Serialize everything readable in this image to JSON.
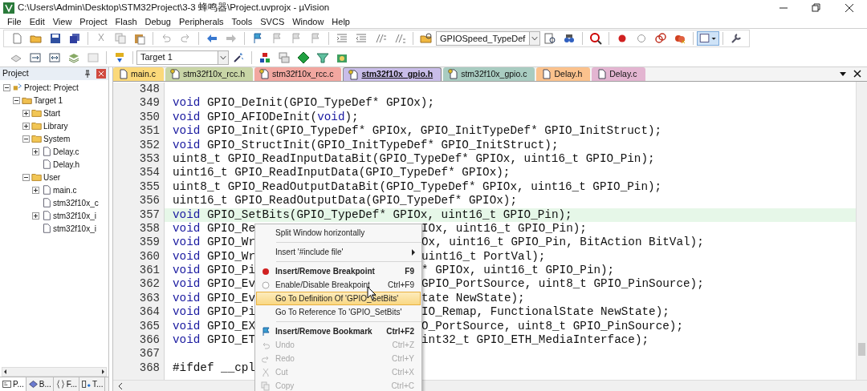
{
  "window": {
    "title": "C:\\Users\\Admin\\Desktop\\STM32Project\\3-3 蜂鸣器\\Project.uvprojx - µVision"
  },
  "menu_bar": [
    "File",
    "Edit",
    "View",
    "Project",
    "Flash",
    "Debug",
    "Peripherals",
    "Tools",
    "SVCS",
    "Window",
    "Help"
  ],
  "toolbar": {
    "find_combo": "GPIOSpeed_TypeDef",
    "target_combo": "Target 1"
  },
  "project_panel": {
    "title": "Project",
    "tree": [
      {
        "label": "Project: Project",
        "kind": "project",
        "expanded": true,
        "children": [
          {
            "label": "Target 1",
            "kind": "target",
            "expanded": true,
            "children": [
              {
                "label": "Start",
                "kind": "folder",
                "expanded": false
              },
              {
                "label": "Library",
                "kind": "folder",
                "expanded": false
              },
              {
                "label": "System",
                "kind": "folder",
                "expanded": true,
                "children": [
                  {
                    "label": "Delay.c",
                    "kind": "file",
                    "expanded": false
                  },
                  {
                    "label": "Delay.h",
                    "kind": "file"
                  }
                ]
              },
              {
                "label": "User",
                "kind": "folder",
                "expanded": true,
                "children": [
                  {
                    "label": "main.c",
                    "kind": "file",
                    "expanded": false
                  },
                  {
                    "label": "stm32f10x_c",
                    "kind": "file"
                  },
                  {
                    "label": "stm32f10x_i",
                    "kind": "file",
                    "expanded": false
                  },
                  {
                    "label": "stm32f10x_i",
                    "kind": "file"
                  }
                ]
              }
            ]
          }
        ]
      }
    ],
    "bottom_tabs": [
      {
        "label": "P...",
        "kind": "project",
        "selected": true
      },
      {
        "label": "B...",
        "kind": "books",
        "selected": false
      },
      {
        "label": "F...",
        "kind": "functions",
        "selected": false
      },
      {
        "label": "T...",
        "kind": "templates",
        "selected": false
      }
    ]
  },
  "editor": {
    "tabs": [
      {
        "label": "main.c",
        "color": "#fbd97a",
        "locked": false,
        "selected": false
      },
      {
        "label": "stm32f10x_rcc.h",
        "color": "#c8d5a6",
        "locked": true,
        "selected": false
      },
      {
        "label": "stm32f10x_rcc.c",
        "color": "#f2a7a0",
        "locked": true,
        "selected": false
      },
      {
        "label": "stm32f10x_gpio.h",
        "color": "#c9bde9",
        "locked": true,
        "selected": true
      },
      {
        "label": "stm32f10x_gpio.c",
        "color": "#a9ccc1",
        "locked": true,
        "selected": false
      },
      {
        "label": "Delay.h",
        "color": "#fbc28d",
        "locked": false,
        "selected": false
      },
      {
        "label": "Delay.c",
        "color": "#e3b5d1",
        "locked": false,
        "selected": false
      }
    ],
    "lines": [
      {
        "number": "348",
        "current": false
      },
      {
        "number": "349",
        "current": false,
        "segments": [
          {
            "kind": "keyword",
            "text": "void"
          },
          {
            "kind": "plain",
            "text": " GPIO_DeInit(GPIO_TypeDef* GPIOx);"
          }
        ]
      },
      {
        "number": "350",
        "current": false,
        "segments": [
          {
            "kind": "keyword",
            "text": "void"
          },
          {
            "kind": "plain",
            "text": " GPIO_AFIODeInit("
          },
          {
            "kind": "keyword",
            "text": "void"
          },
          {
            "kind": "plain",
            "text": ");"
          }
        ]
      },
      {
        "number": "351",
        "current": false,
        "segments": [
          {
            "kind": "keyword",
            "text": "void"
          },
          {
            "kind": "plain",
            "text": " GPIO_Init(GPIO_TypeDef* GPIOx, GPIO_InitTypeDef* GPIO_InitStruct);"
          }
        ]
      },
      {
        "number": "352",
        "current": false,
        "segments": [
          {
            "kind": "keyword",
            "text": "void"
          },
          {
            "kind": "plain",
            "text": " GPIO_StructInit(GPIO_InitTypeDef* GPIO_InitStruct);"
          }
        ]
      },
      {
        "number": "353",
        "current": false,
        "segments": [
          {
            "kind": "plain",
            "text": "uint8_t GPIO_ReadInputDataBit(GPIO_TypeDef* GPIOx, uint16_t GPIO_Pin);"
          }
        ]
      },
      {
        "number": "354",
        "current": false,
        "segments": [
          {
            "kind": "plain",
            "text": "uint16_t GPIO_ReadInputData(GPIO_TypeDef* GPIOx);"
          }
        ]
      },
      {
        "number": "355",
        "current": false,
        "segments": [
          {
            "kind": "plain",
            "text": "uint8_t GPIO_ReadOutputDataBit(GPIO_TypeDef* GPIOx, uint16_t GPIO_Pin);"
          }
        ]
      },
      {
        "number": "356",
        "current": false,
        "segments": [
          {
            "kind": "plain",
            "text": "uint16_t GPIO_ReadOutputData(GPIO_TypeDef* GPIOx);"
          }
        ]
      },
      {
        "number": "357",
        "current": true,
        "segments": [
          {
            "kind": "keyword",
            "text": "void"
          },
          {
            "kind": "plain",
            "text": " GPIO_SetBits(GPIO_TypeDef* GPIOx, uint16_t GPIO_Pin);"
          }
        ]
      },
      {
        "number": "358",
        "current": false,
        "segments": [
          {
            "kind": "keyword",
            "text": "void"
          },
          {
            "kind": "plain",
            "text": " GPIO_Re"
          }
        ],
        "after_menu": "IOx, uint16_t GPIO_Pin);"
      },
      {
        "number": "359",
        "current": false,
        "segments": [
          {
            "kind": "keyword",
            "text": "void"
          },
          {
            "kind": "plain",
            "text": " GPIO_Wr"
          }
        ],
        "after_menu": "Ox, uint16_t GPIO_Pin, BitAction BitVal);"
      },
      {
        "number": "360",
        "current": false,
        "segments": [
          {
            "kind": "keyword",
            "text": "void"
          },
          {
            "kind": "plain",
            "text": " GPIO_Wr"
          }
        ],
        "after_menu": "uint16_t PortVal);"
      },
      {
        "number": "361",
        "current": false,
        "segments": [
          {
            "kind": "keyword",
            "text": "void"
          },
          {
            "kind": "plain",
            "text": " GPIO_Pi"
          }
        ],
        "after_menu": "* GPIOx, uint16_t GPIO_Pin);"
      },
      {
        "number": "362",
        "current": false,
        "segments": [
          {
            "kind": "keyword",
            "text": "void"
          },
          {
            "kind": "plain",
            "text": " GPIO_Ev"
          }
        ],
        "after_menu": "GPIO_PortSource, uint8_t GPIO_PinSource);"
      },
      {
        "number": "363",
        "current": false,
        "segments": [
          {
            "kind": "keyword",
            "text": "void"
          },
          {
            "kind": "plain",
            "text": " GPIO_Ev"
          }
        ],
        "after_menu": "tate NewState);"
      },
      {
        "number": "364",
        "current": false,
        "segments": [
          {
            "kind": "keyword",
            "text": "void"
          },
          {
            "kind": "plain",
            "text": " GPIO_Pi"
          }
        ],
        "after_menu": "IO_Remap, FunctionalState NewState);"
      },
      {
        "number": "365",
        "current": false,
        "segments": [
          {
            "kind": "keyword",
            "text": "void"
          },
          {
            "kind": "plain",
            "text": " GPIO_EX"
          }
        ],
        "after_menu": "O_PortSource, uint8_t GPIO_PinSource);"
      },
      {
        "number": "366",
        "current": false,
        "segments": [
          {
            "kind": "keyword",
            "text": "void"
          },
          {
            "kind": "plain",
            "text": " GPIO_ET"
          }
        ],
        "after_menu": "int32_t GPIO_ETH_MediaInterface);"
      },
      {
        "number": "367",
        "current": false
      },
      {
        "number": "368",
        "current": false,
        "segments": [
          {
            "kind": "plain",
            "text": "#ifdef __cpl"
          }
        ]
      }
    ]
  },
  "context_menu": [
    {
      "kind": "item",
      "label": "Split Window horizontally",
      "disabled": false,
      "selected": false
    },
    {
      "kind": "separator"
    },
    {
      "kind": "submenu",
      "label": "Insert '#include file'",
      "disabled": false,
      "selected": false
    },
    {
      "kind": "separator"
    },
    {
      "kind": "item",
      "label": "Insert/Remove Breakpoint",
      "shortcut": "F9",
      "disabled": false,
      "selected": false
    },
    {
      "kind": "item",
      "label": "Enable/Disable Breakpoint",
      "shortcut": "Ctrl+F9",
      "disabled": false,
      "selected": false
    },
    {
      "kind": "item",
      "label": "Go To Definition Of 'GPIO_SetBits'",
      "disabled": false,
      "selected": true
    },
    {
      "kind": "item",
      "label": "Go To Reference To 'GPIO_SetBits'",
      "disabled": false,
      "selected": false
    },
    {
      "kind": "separator"
    },
    {
      "kind": "item",
      "label": "Insert/Remove Bookmark",
      "shortcut": "Ctrl+F2",
      "disabled": false,
      "selected": false
    },
    {
      "kind": "item",
      "label": "Undo",
      "shortcut": "Ctrl+Z",
      "disabled": true,
      "selected": false
    },
    {
      "kind": "item",
      "label": "Redo",
      "shortcut": "Ctrl+Y",
      "disabled": true,
      "selected": false
    },
    {
      "kind": "item",
      "label": "Cut",
      "shortcut": "Ctrl+X",
      "disabled": true,
      "selected": false
    },
    {
      "kind": "item",
      "label": "Copy",
      "shortcut": "Ctrl+C",
      "disabled": true,
      "selected": false
    }
  ]
}
